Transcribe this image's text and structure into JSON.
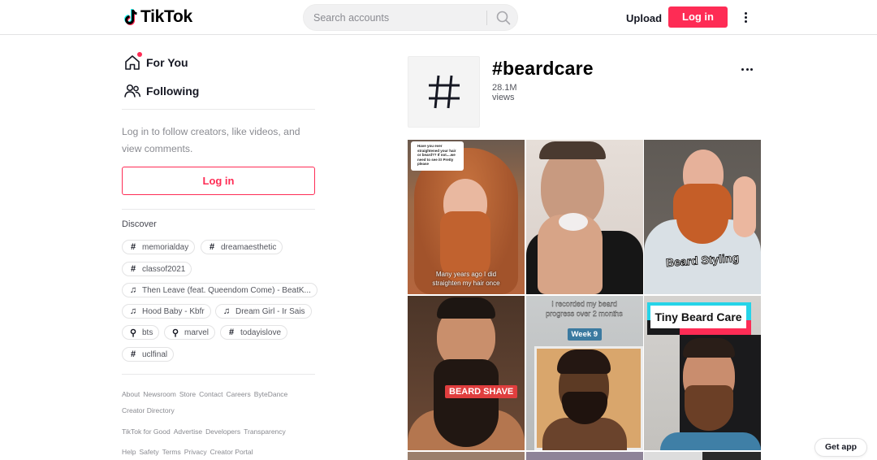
{
  "header": {
    "logo_text": "TikTok",
    "search_placeholder": "Search accounts",
    "upload_label": "Upload",
    "login_label": "Log in"
  },
  "sidebar": {
    "nav": [
      {
        "label": "For You",
        "icon": "home-icon",
        "active_dot": true
      },
      {
        "label": "Following",
        "icon": "users-icon"
      }
    ],
    "login_prompt": "Log in to follow creators, like videos, and view comments.",
    "login_label": "Log in",
    "discover_title": "Discover",
    "discover_chips": [
      {
        "icon": "hashtag-icon",
        "label": "memorialday"
      },
      {
        "icon": "hashtag-icon",
        "label": "dreamaesthetic"
      },
      {
        "icon": "hashtag-icon",
        "label": "classof2021"
      },
      {
        "icon": "music-icon",
        "label": "Then Leave (feat. Queendom Come) - BeatK..."
      },
      {
        "icon": "music-icon",
        "label": "Hood Baby - Kbfr"
      },
      {
        "icon": "music-icon",
        "label": "Dream Girl - Ir Sais"
      },
      {
        "icon": "search-icon",
        "label": "bts"
      },
      {
        "icon": "search-icon",
        "label": "marvel"
      },
      {
        "icon": "hashtag-icon",
        "label": "todayislove"
      },
      {
        "icon": "hashtag-icon",
        "label": "uclfinal"
      }
    ],
    "footer": [
      [
        "About",
        "Newsroom",
        "Store",
        "Contact",
        "Careers",
        "ByteDance"
      ],
      [
        "Creator Directory"
      ],
      [
        "TikTok for Good",
        "Advertise",
        "Developers",
        "Transparency"
      ],
      [
        "Help",
        "Safety",
        "Terms",
        "Privacy",
        "Creator Portal"
      ]
    ]
  },
  "tag": {
    "title": "#beardcare",
    "views": "28.1M views"
  },
  "videos": [
    {
      "caption": "Many years ago I did straighten my hair once",
      "comment": "Have you ever straightened your hair or beard?? If not....we need to see it! Pretty please"
    },
    {
      "caption": ""
    },
    {
      "caption": "Beard Styling"
    },
    {
      "caption": "BEARD SHAVE"
    },
    {
      "caption": "I recorded my beard progress over 2 months",
      "badge": "Week 9"
    },
    {
      "caption": "Tiny Beard Care"
    }
  ],
  "get_app_label": "Get app",
  "colors": {
    "brand": "#fe2c55",
    "text": "#161823",
    "muted": "#8a8b91"
  }
}
